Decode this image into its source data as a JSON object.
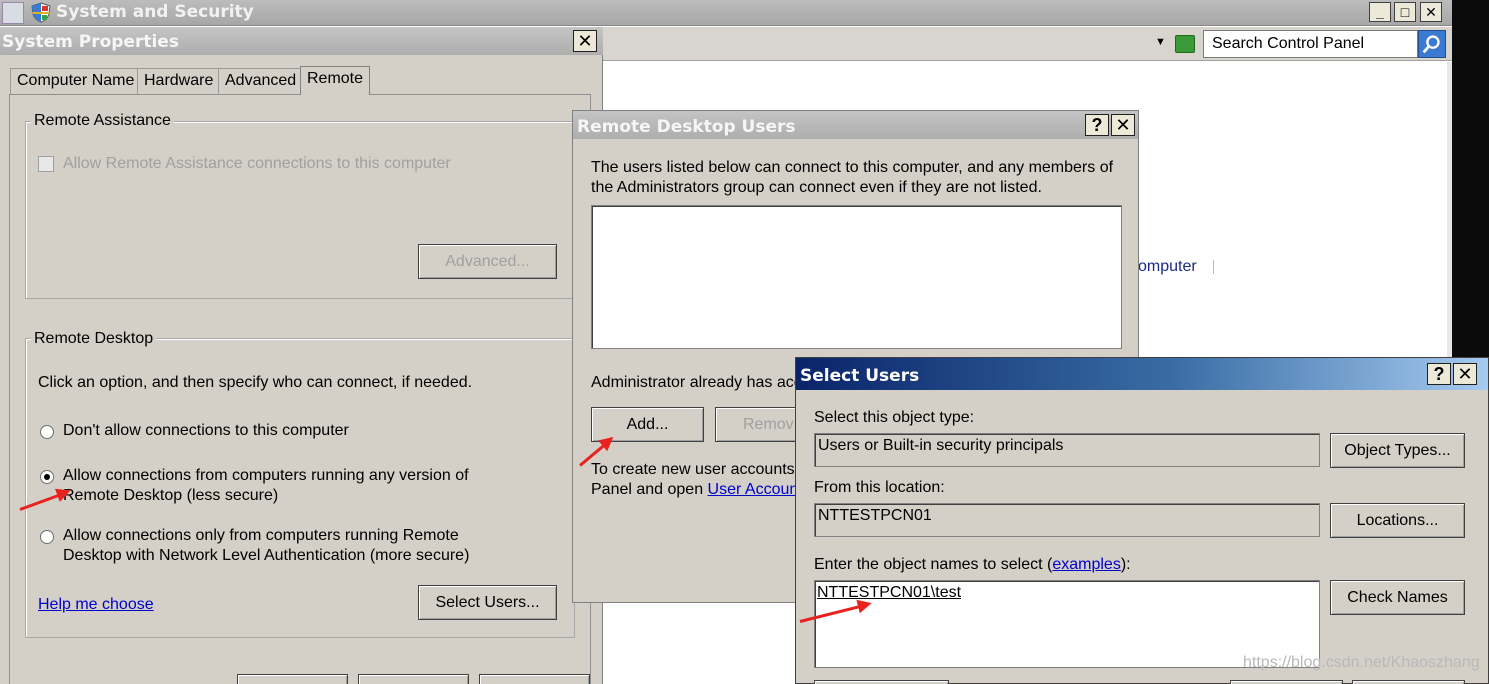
{
  "control_panel": {
    "title": "System and Security",
    "search_placeholder": "Search Control Panel",
    "partial_link": "omputer",
    "dropdown_glyph": "▼",
    "controls": {
      "minimize": "_",
      "maximize": "□",
      "close": "✕"
    }
  },
  "system_properties": {
    "title": "System Properties",
    "tabs": [
      "Computer Name",
      "Hardware",
      "Advanced",
      "Remote"
    ],
    "active_tab": "Remote",
    "remote_assistance": {
      "label": "Remote Assistance",
      "checkbox_label": "Allow Remote Assistance connections to this computer",
      "checked": false,
      "advanced_button": "Advanced..."
    },
    "remote_desktop": {
      "label": "Remote Desktop",
      "instruction": "Click an option, and then specify who can connect, if needed.",
      "option_1": "Don't allow connections to this computer",
      "option_2_line1": "Allow connections from computers running any version of",
      "option_2_line2": "Remote Desktop (less secure)",
      "option_3_line1": "Allow connections only from computers running Remote",
      "option_3_line2": "Desktop with Network Level Authentication (more secure)",
      "selected_option": 2,
      "help_link": "Help me choose",
      "select_users_button": "Select Users..."
    }
  },
  "remote_desktop_users": {
    "title": "Remote Desktop Users",
    "description_line1": "The users listed below can connect to this computer, and any members of",
    "description_line2": "the Administrators group can connect even if they are not listed.",
    "admin_note": "Administrator already has acc",
    "add_button": "Add...",
    "remove_button": "Remov",
    "create_note_line1": "To create new user accounts",
    "create_note_line2_prefix": "Panel and open ",
    "create_note_link": "User Accoun"
  },
  "select_users": {
    "title": "Select Users",
    "object_type_label": "Select this object type:",
    "object_type_value": "Users or Built-in security principals",
    "object_types_button": "Object Types...",
    "location_label": "From this location:",
    "location_value": "NTTESTPCN01",
    "locations_button": "Locations...",
    "names_label_prefix": "Enter the object names to select (",
    "names_label_link": "examples",
    "names_label_suffix": "):",
    "names_value": "NTTESTPCN01\\test",
    "check_names_button": "Check Names"
  },
  "dialog_controls": {
    "help": "?",
    "close": "✕"
  },
  "watermark": "https://blog.csdn.net/Khaoszhang",
  "colors": {
    "arrow": "#e8221f",
    "select_users_title_start": "#0a246a",
    "link": "#0000cc"
  }
}
